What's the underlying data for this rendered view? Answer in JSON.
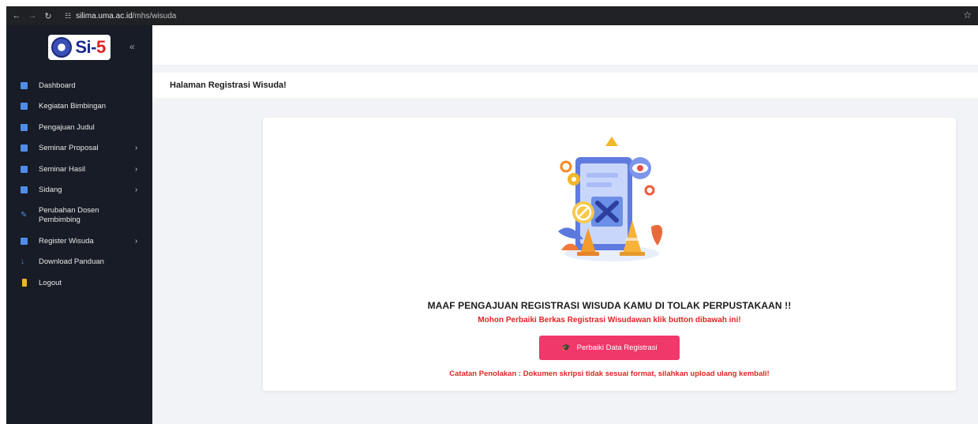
{
  "browser": {
    "url_host": "silima.uma.ac.id",
    "url_path": "/mhs/wisuda",
    "icons": [
      "back-arrow-icon",
      "forward-arrow-icon",
      "reload-icon",
      "site-info-icon",
      "star-icon"
    ]
  },
  "sidebar": {
    "logo_text": "Si-",
    "logo_number": "5",
    "items": [
      {
        "label": "Dashboard",
        "icon": "dashboard-icon",
        "arrow": false
      },
      {
        "label": "Kegiatan Bimbingan",
        "icon": "document-icon",
        "arrow": false
      },
      {
        "label": "Pengajuan Judul",
        "icon": "document-icon",
        "arrow": false
      },
      {
        "label": "Seminar Proposal",
        "icon": "document-icon",
        "arrow": true
      },
      {
        "label": "Seminar Hasil",
        "icon": "document-icon",
        "arrow": true
      },
      {
        "label": "Sidang",
        "icon": "document-icon",
        "arrow": true
      },
      {
        "label": "Perubahan Dosen Pembimbing",
        "icon": "pencil-icon",
        "arrow": false
      },
      {
        "label": "Register Wisuda",
        "icon": "document-icon",
        "arrow": true
      },
      {
        "label": "Download Panduan",
        "icon": "download-icon",
        "arrow": false
      },
      {
        "label": "Logout",
        "icon": "logout-icon",
        "arrow": false
      }
    ]
  },
  "page": {
    "title": "Halaman Registrasi Wisuda!"
  },
  "card": {
    "message_main": "MAAF PENGAJUAN REGISTRASI WISUDA KAMU DI TOLAK PERPUSTAKAAN !!",
    "message_sub": "Mohon Perbaiki Berkas Registrasi Wisudawan klik button dibawah ini!",
    "button_label": "Perbaiki Data Registrasi",
    "rejection_note": "Catatan Penolakan : Dokumen skripsi tidak sesuai format, silahkan upload ulang kembali!"
  },
  "colors": {
    "sidebar_bg": "#171c26",
    "accent_button": "#f0386b",
    "error_text": "#e02424",
    "menu_icon": "#4f8de8"
  }
}
